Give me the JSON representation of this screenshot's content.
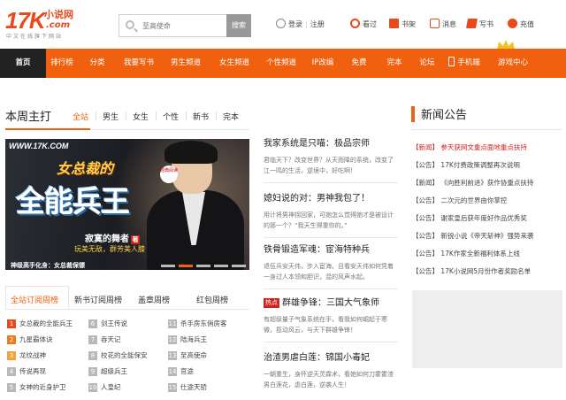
{
  "header": {
    "logo": {
      "main": "17K",
      "cn": "小说网",
      "com": ".com",
      "slogan": "中文在线旗下网站"
    },
    "search": {
      "placeholder": "至高使命",
      "button": "搜索"
    },
    "user": {
      "login": "登录",
      "register": "注册",
      "history": "看过",
      "bookshelf": "书架",
      "messages": "消息",
      "write": "写书",
      "recharge": "充值"
    }
  },
  "nav": {
    "items": [
      "首页",
      "排行榜",
      "分类",
      "我要写书",
      "男生频道",
      "女生频道",
      "个性频道",
      "IP改编",
      "免费",
      "完本",
      "论坛",
      "手机端",
      "游戏中心"
    ],
    "active_index": 0
  },
  "weekly": {
    "title": "本周主打",
    "tabs": [
      "全站",
      "男生",
      "女生",
      "个性",
      "新书",
      "完本"
    ],
    "active_tab": 0
  },
  "banner": {
    "watermark": "WWW.17K.COM",
    "line1": "女总裁的",
    "line2": "全能兵王",
    "badge": "经典阅读",
    "author": "寂寞的舞者",
    "author_tag": "著",
    "tagline": "玩美无敌，群芳美人膝",
    "caption": "神级高手化身：女总裁保镖",
    "slides": 5,
    "active_slide": 1
  },
  "news_mid": [
    {
      "hot": "",
      "title": "我家系统是只喵：极品宗师",
      "desc": "君临天下？改变世界？从天而降的系统，改变了江一鸣的生活，逆境中，好吃啊！"
    },
    {
      "hot": "",
      "title": "媳妇说的对：男神我包了！",
      "desc": "用计将男神拐回家，可她怎么觉得她才是被设计的那一个？“我天生得重你的。”"
    },
    {
      "hot": "",
      "title": "铁骨锻造军魂：宦海特种兵",
      "desc": "退伍兵安天伟，步入宦海。且看安天伟如何凭着一身过人本领和胆识，混的风声水起。"
    },
    {
      "hot": "热点",
      "title": "群雄争锋：三国大气象师",
      "desc": "有超级量子气象系统在手，看我如何崛起于寒微，揽动风云，与天下群雄争锋！"
    },
    {
      "hot": "",
      "title": "治渣男虐白莲：锦国小毒妃",
      "desc": "一朝重生，身怀逆天灵霖术，看她如何刀霍霍渣男白莲花，虐白莲，逆袭人生！"
    }
  ],
  "announcements": {
    "title": "新闻公告",
    "items": [
      {
        "text": "【新闻】 参天获网文重点面地重点扶持",
        "red": true
      },
      {
        "text": "【公告】 17K付费政策调整再次说明",
        "red": false
      },
      {
        "text": "【新闻】 《向胜利前进》获作协重点扶持",
        "red": false
      },
      {
        "text": "【公告】 二次元的世界由你掌控",
        "red": false
      },
      {
        "text": "【公告】 谢家皇后获年度好作品优秀奖",
        "red": false
      },
      {
        "text": "【公告】 新锐小说《帝天斩神》强势来袭",
        "red": false
      },
      {
        "text": "【公告】 17K作家全新福利体系上线",
        "red": false
      },
      {
        "text": "【公告】 17K小说网5月份作者奖励名单",
        "red": false
      }
    ]
  },
  "rank_tabs": [
    "全站订阅周榜",
    "新书订阅周榜",
    "盖章周榜",
    "红包周榜"
  ],
  "rank_active": 0,
  "rank_cols": [
    [
      {
        "n": "1",
        "t": "女总裁的全能兵王"
      },
      {
        "n": "2",
        "t": "九星霸体诀"
      },
      {
        "n": "3",
        "t": "龙纹战神"
      },
      {
        "n": "4",
        "t": "传说再现"
      },
      {
        "n": "5",
        "t": "女神的近身护卫"
      }
    ],
    [
      {
        "n": "6",
        "t": "剑王传说"
      },
      {
        "n": "7",
        "t": "吞天记"
      },
      {
        "n": "8",
        "t": "校花的全能保安"
      },
      {
        "n": "9",
        "t": "超级兵王"
      },
      {
        "n": "10",
        "t": "人皇纪"
      }
    ],
    [
      {
        "n": "11",
        "t": "杀手房东俏房客"
      },
      {
        "n": "12",
        "t": "陆海兵王"
      },
      {
        "n": "13",
        "t": "至高使命"
      },
      {
        "n": "14",
        "t": "官途"
      },
      {
        "n": "15",
        "t": "仕途天骄"
      }
    ]
  ],
  "colors": {
    "accent": "#f0600f",
    "dark": "#222222",
    "red": "#d0211c"
  }
}
